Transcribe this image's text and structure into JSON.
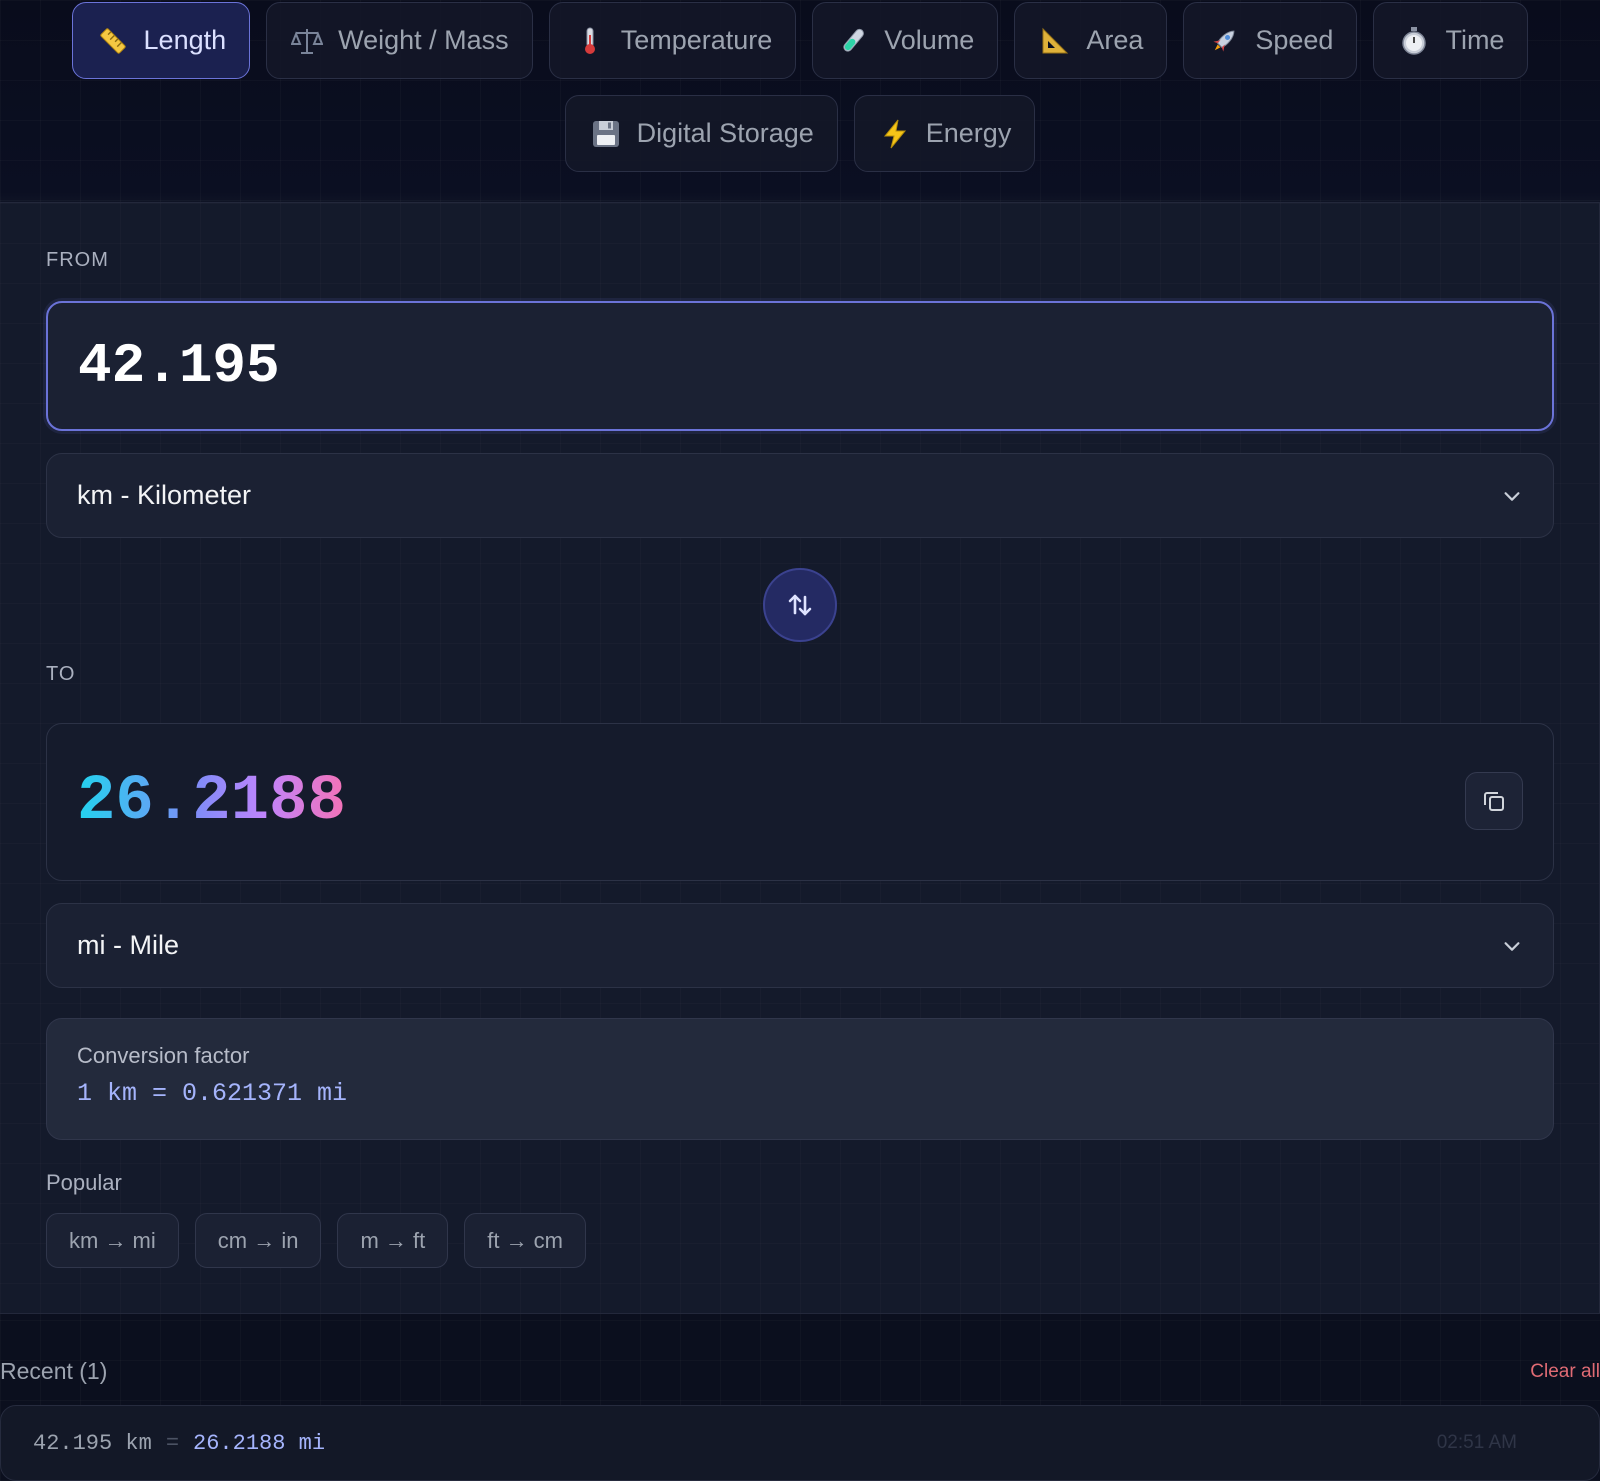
{
  "categories": [
    {
      "label": "Length",
      "icon": "ruler-icon",
      "active": true
    },
    {
      "label": "Weight / Mass",
      "icon": "scales-icon",
      "active": false
    },
    {
      "label": "Temperature",
      "icon": "thermometer-icon",
      "active": false
    },
    {
      "label": "Volume",
      "icon": "test-tube-icon",
      "active": false
    },
    {
      "label": "Area",
      "icon": "triangle-ruler-icon",
      "active": false
    },
    {
      "label": "Speed",
      "icon": "rocket-icon",
      "active": false
    },
    {
      "label": "Time",
      "icon": "stopwatch-icon",
      "active": false
    },
    {
      "label": "Digital Storage",
      "icon": "floppy-disk-icon",
      "active": false
    },
    {
      "label": "Energy",
      "icon": "lightning-icon",
      "active": false
    }
  ],
  "from": {
    "label": "FROM",
    "value": "42.195",
    "unit": "km - Kilometer"
  },
  "to": {
    "label": "TO",
    "value": "26.2188",
    "unit": "mi - Mile"
  },
  "conversion": {
    "title": "Conversion factor",
    "formula": "1 km = 0.621371 mi"
  },
  "popular": {
    "label": "Popular",
    "items": [
      "km → mi",
      "cm → in",
      "m → ft",
      "ft → cm"
    ]
  },
  "recent": {
    "title": "Recent (1)",
    "clear_label": "Clear all",
    "items": [
      {
        "from": "42.195 km",
        "eq": "=",
        "to": "26.2188 mi",
        "time": "02:51 AM"
      }
    ]
  },
  "colors": {
    "accent": "#6b73d8",
    "active_tab_bg": "#1b2150",
    "clear": "#e06b74",
    "result_gradient": [
      "#22d3ee",
      "#818cf8",
      "#f472b6"
    ]
  }
}
